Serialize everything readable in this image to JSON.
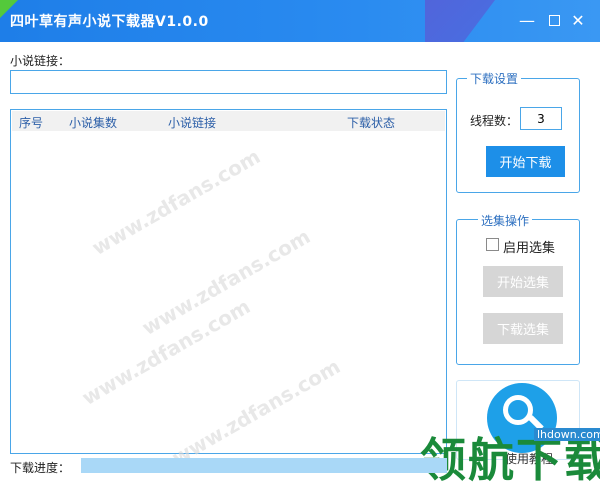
{
  "window": {
    "title": "四叶草有声小说下载器V1.0.0",
    "minimize": "—",
    "close": "✕"
  },
  "novel_url": {
    "label": "小说链接：",
    "value": ""
  },
  "table": {
    "columns": [
      "序号",
      "小说集数",
      "小说链接",
      "下载状态"
    ],
    "rows": []
  },
  "download_settings": {
    "group_title": "下载设置",
    "thread_label": "线程数：",
    "thread_value": "3",
    "start_download": "开始下载"
  },
  "selection": {
    "group_title": "选集操作",
    "enable_label": "启用选集",
    "enabled": false,
    "start_select": "开始选集",
    "download_select": "下载选集"
  },
  "progress": {
    "label": "下载进度：",
    "value": 0
  },
  "watermark": {
    "brand": "领航下载",
    "domain": "lhdown.com",
    "help": "使用教程",
    "site": "www.zdfans.com"
  },
  "colors": {
    "accent": "#1d8fe8",
    "border": "#4aa6e8",
    "progress": "#a9d8f7"
  }
}
